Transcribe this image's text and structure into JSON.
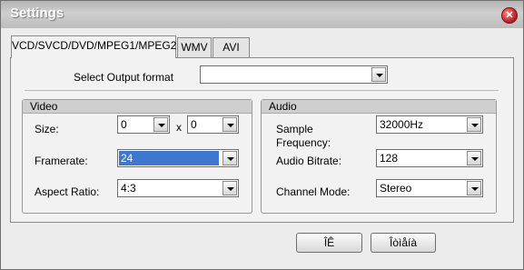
{
  "window": {
    "title": "Settings",
    "close_glyph": "✕"
  },
  "tabs": [
    {
      "label": "VCD/SVCD/DVD/MPEG1/MPEG2",
      "active": true
    },
    {
      "label": "WMV",
      "active": false
    },
    {
      "label": "AVI",
      "active": false
    }
  ],
  "output_format": {
    "label": "Select Output format",
    "value": ""
  },
  "video": {
    "title": "Video",
    "size_label": "Size:",
    "width": "0",
    "x_sep": "x",
    "height": "0",
    "framerate_label": "Framerate:",
    "framerate": "24",
    "aspect_label": "Aspect Ratio:",
    "aspect": "4:3"
  },
  "audio": {
    "title": "Audio",
    "sample_label_line1": "Sample",
    "sample_label_line2": "Frequency:",
    "sample": "32000Hz",
    "bitrate_label": "Audio Bitrate:",
    "bitrate": "128",
    "channel_label": "Channel Mode:",
    "channel": "Stereo"
  },
  "buttons": {
    "ok": "ÎÊ",
    "cancel": "Îòìåíà"
  },
  "icons": {
    "close": "close-icon",
    "dropdown": "chevron-down-icon"
  },
  "colors": {
    "titlebar": "#c4c4c4",
    "selection": "#3e77cf",
    "close": "#c1272d"
  }
}
